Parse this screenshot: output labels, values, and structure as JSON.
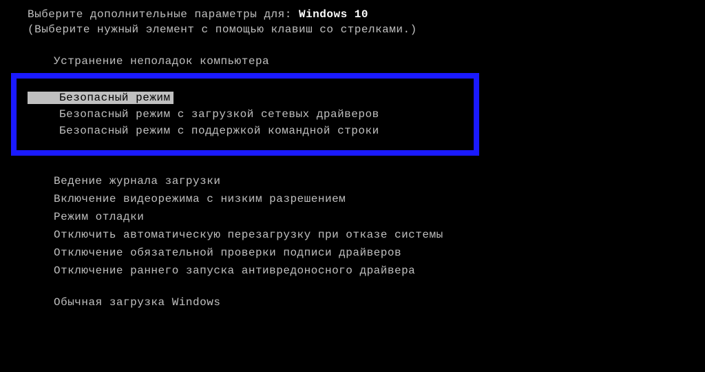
{
  "header": {
    "prompt_prefix": "Выберите дополнительные параметры для: ",
    "os_name": "Windows 10",
    "hint": "(Выберите нужный элемент с помощью клавиш со стрелками.)"
  },
  "options": {
    "repair": "Устранение неполадок компьютера",
    "safe_mode": "Безопасный режим",
    "safe_mode_net": "Безопасный режим с загрузкой сетевых драйверов",
    "safe_mode_cmd": "Безопасный режим с поддержкой командной строки",
    "boot_logging": "Ведение журнала загрузки",
    "low_res_video": "Включение видеорежима с низким разрешением",
    "debug_mode": "Режим отладки",
    "disable_auto_restart": "Отключить автоматическую перезагрузку при отказе системы",
    "disable_driver_sig": "Отключение обязательной проверки подписи драйверов",
    "disable_early_antimalware": "Отключение раннего запуска антивредоносного драйвера",
    "normal_boot": "Обычная загрузка Windows"
  }
}
